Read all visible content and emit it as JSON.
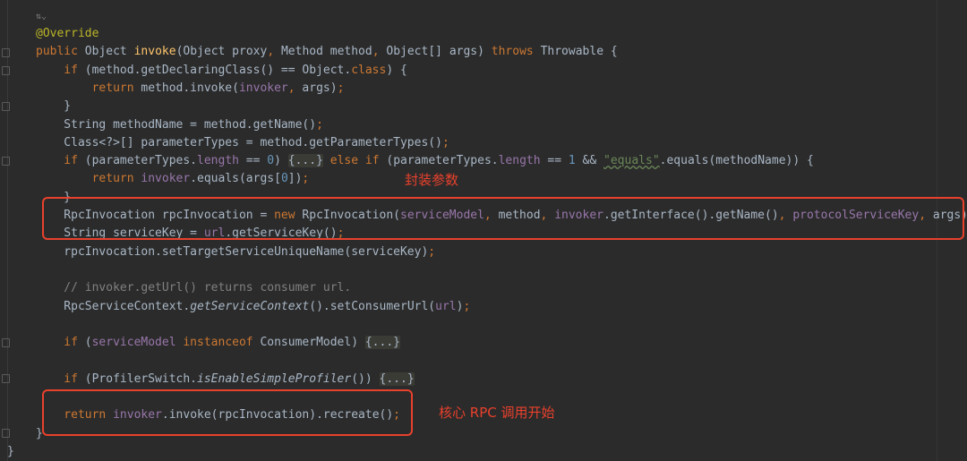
{
  "editor": {
    "usage_hint": "⇅⌄",
    "lines": [
      {
        "indent": 0,
        "tokens": [
          {
            "t": "@Override",
            "c": "an"
          }
        ]
      },
      {
        "indent": 0,
        "tokens": [
          {
            "t": "public ",
            "c": "kw"
          },
          {
            "t": "Object ",
            "c": "df"
          },
          {
            "t": "invoke",
            "c": "mt"
          },
          {
            "t": "(Object proxy",
            "c": "df"
          },
          {
            "t": ", ",
            "c": "kw"
          },
          {
            "t": "Method method",
            "c": "df"
          },
          {
            "t": ", ",
            "c": "kw"
          },
          {
            "t": "Object[] args) ",
            "c": "df"
          },
          {
            "t": "throws ",
            "c": "kw"
          },
          {
            "t": "Throwable {",
            "c": "df"
          }
        ]
      },
      {
        "indent": 1,
        "tokens": [
          {
            "t": "if ",
            "c": "kw"
          },
          {
            "t": "(method.getDeclaringClass() == Object.",
            "c": "df"
          },
          {
            "t": "class",
            "c": "kw"
          },
          {
            "t": ") {",
            "c": "df"
          }
        ]
      },
      {
        "indent": 2,
        "tokens": [
          {
            "t": "return ",
            "c": "kw"
          },
          {
            "t": "method.invoke(",
            "c": "df"
          },
          {
            "t": "invoker",
            "c": "fd"
          },
          {
            "t": ", ",
            "c": "kw"
          },
          {
            "t": "args)",
            "c": "df"
          },
          {
            "t": ";",
            "c": "kw"
          }
        ]
      },
      {
        "indent": 1,
        "tokens": [
          {
            "t": "}",
            "c": "df"
          }
        ]
      },
      {
        "indent": 1,
        "tokens": [
          {
            "t": "String methodName = method.getName()",
            "c": "df"
          },
          {
            "t": ";",
            "c": "kw"
          }
        ]
      },
      {
        "indent": 1,
        "tokens": [
          {
            "t": "Class<?>[] parameterTypes = method.getParameterTypes()",
            "c": "df"
          },
          {
            "t": ";",
            "c": "kw"
          }
        ]
      },
      {
        "indent": 1,
        "tokens": [
          {
            "t": "if ",
            "c": "kw"
          },
          {
            "t": "(parameterTypes.",
            "c": "df"
          },
          {
            "t": "length ",
            "c": "fd"
          },
          {
            "t": "== ",
            "c": "df"
          },
          {
            "t": "0",
            "c": "nm"
          },
          {
            "t": ") ",
            "c": "df"
          },
          {
            "t": "{...}",
            "c": "fold"
          },
          {
            "t": " else if ",
            "c": "kw"
          },
          {
            "t": "(parameterTypes.",
            "c": "df"
          },
          {
            "t": "length ",
            "c": "fd"
          },
          {
            "t": "== ",
            "c": "df"
          },
          {
            "t": "1 ",
            "c": "nm"
          },
          {
            "t": "&& ",
            "c": "df"
          },
          {
            "t": "\"equals\"",
            "c": "st"
          },
          {
            "t": ".equals(methodName)) {",
            "c": "df"
          }
        ]
      },
      {
        "indent": 2,
        "tokens": [
          {
            "t": "return ",
            "c": "kw"
          },
          {
            "t": "invoker",
            "c": "fd"
          },
          {
            "t": ".equals(args[",
            "c": "df"
          },
          {
            "t": "0",
            "c": "nm"
          },
          {
            "t": "])",
            "c": "df"
          },
          {
            "t": ";",
            "c": "kw"
          }
        ]
      },
      {
        "indent": 1,
        "tokens": [
          {
            "t": "}",
            "c": "df"
          }
        ]
      },
      {
        "indent": 1,
        "tokens": [
          {
            "t": "RpcInvocation rpcInvocation = ",
            "c": "df"
          },
          {
            "t": "new ",
            "c": "kw"
          },
          {
            "t": "RpcInvocation(",
            "c": "df"
          },
          {
            "t": "serviceModel",
            "c": "fd"
          },
          {
            "t": ", ",
            "c": "kw"
          },
          {
            "t": "method",
            "c": "df"
          },
          {
            "t": ", ",
            "c": "kw"
          },
          {
            "t": "invoker",
            "c": "fd"
          },
          {
            "t": ".getInterface().getName()",
            "c": "df"
          },
          {
            "t": ", ",
            "c": "kw"
          },
          {
            "t": "protocolServiceKey",
            "c": "fd"
          },
          {
            "t": ", ",
            "c": "kw"
          },
          {
            "t": "args)",
            "c": "df"
          },
          {
            "t": ";",
            "c": "kw"
          }
        ]
      },
      {
        "indent": 1,
        "tokens": [
          {
            "t": "String serviceKey = ",
            "c": "df"
          },
          {
            "t": "url",
            "c": "fd"
          },
          {
            "t": ".getServiceKey()",
            "c": "df"
          },
          {
            "t": ";",
            "c": "kw"
          }
        ]
      },
      {
        "indent": 1,
        "tokens": [
          {
            "t": "rpcInvocation.setTargetServiceUniqueName(serviceKey)",
            "c": "df"
          },
          {
            "t": ";",
            "c": "kw"
          }
        ]
      },
      {
        "indent": 0,
        "tokens": []
      },
      {
        "indent": 1,
        "tokens": [
          {
            "t": "// invoker.getUrl() returns consumer url.",
            "c": "cm"
          }
        ]
      },
      {
        "indent": 1,
        "tokens": [
          {
            "t": "RpcServiceContext.",
            "c": "df"
          },
          {
            "t": "getServiceContext",
            "c": "df it"
          },
          {
            "t": "().setConsumerUrl(",
            "c": "df"
          },
          {
            "t": "url",
            "c": "fd"
          },
          {
            "t": ")",
            "c": "df"
          },
          {
            "t": ";",
            "c": "kw"
          }
        ]
      },
      {
        "indent": 0,
        "tokens": []
      },
      {
        "indent": 1,
        "tokens": [
          {
            "t": "if ",
            "c": "kw"
          },
          {
            "t": "(",
            "c": "df"
          },
          {
            "t": "serviceModel ",
            "c": "fd"
          },
          {
            "t": "instanceof ",
            "c": "kw"
          },
          {
            "t": "ConsumerModel) ",
            "c": "df"
          },
          {
            "t": "{...}",
            "c": "fold"
          }
        ]
      },
      {
        "indent": 0,
        "tokens": []
      },
      {
        "indent": 1,
        "tokens": [
          {
            "t": "if ",
            "c": "kw"
          },
          {
            "t": "(ProfilerSwitch.",
            "c": "df"
          },
          {
            "t": "isEnableSimpleProfiler",
            "c": "df it"
          },
          {
            "t": "()) ",
            "c": "df"
          },
          {
            "t": "{...}",
            "c": "fold"
          }
        ]
      },
      {
        "indent": 0,
        "tokens": []
      },
      {
        "indent": 1,
        "tokens": [
          {
            "t": "return ",
            "c": "kw"
          },
          {
            "t": "invoker",
            "c": "fd"
          },
          {
            "t": ".invoke(rpcInvocation).recreate()",
            "c": "df"
          },
          {
            "t": ";",
            "c": "kw"
          }
        ]
      },
      {
        "indent": 0,
        "tokens": [
          {
            "t": "}",
            "c": "df"
          }
        ]
      },
      {
        "indent": -1,
        "tokens": [
          {
            "t": "}",
            "c": "df"
          }
        ]
      }
    ]
  },
  "annotations": {
    "wrap_params": "封装参数",
    "core_rpc_start": "核心 RPC 调用开始"
  },
  "colors": {
    "background": "#2b2b2b",
    "highlight_box": "#e8412c"
  }
}
